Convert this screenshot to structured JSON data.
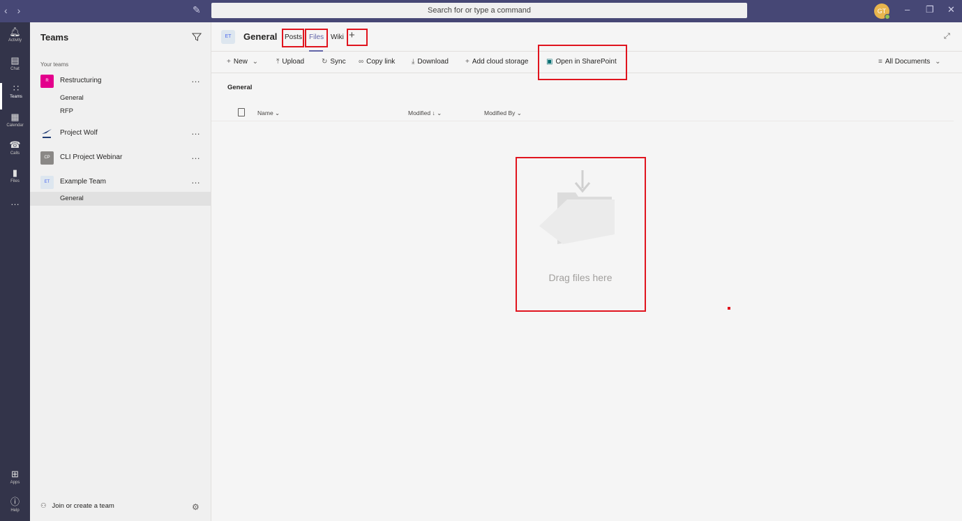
{
  "titlebar": {
    "search_placeholder": "Search for or type a command",
    "user_initials": "GT",
    "back_icon": "chevron-left-icon",
    "forward_icon": "chevron-right-icon"
  },
  "rail": {
    "activity": "Activity",
    "chat": "Chat",
    "teams": "Teams",
    "calendar": "Calendar",
    "calls": "Calls",
    "files": "Files",
    "apps": "Apps",
    "help": "Help"
  },
  "sidebar": {
    "title": "Teams",
    "your_teams_label": "Your teams",
    "teams": [
      {
        "initials": "R",
        "name": "Restructuring",
        "channels": [
          "General",
          "RFP"
        ]
      },
      {
        "initials": "",
        "name": "Project Wolf"
      },
      {
        "initials": "CP",
        "name": "CLI Project Webinar"
      },
      {
        "initials": "ET",
        "name": "Example Team",
        "channels": [
          "General"
        ]
      }
    ],
    "join_label": "Join or create a team"
  },
  "channel": {
    "initials": "ET",
    "title": "General",
    "tabs": [
      "Posts",
      "Files",
      "Wiki"
    ],
    "active_tab": "Files"
  },
  "toolbar": {
    "new": "New",
    "upload": "Upload",
    "sync": "Sync",
    "copy_link": "Copy link",
    "download": "Download",
    "add_cloud": "Add cloud storage",
    "open_sharepoint": "Open in SharePoint",
    "view": "All Documents"
  },
  "files": {
    "breadcrumb": "General",
    "col_name": "Name",
    "col_modified": "Modified",
    "col_modified_by": "Modified By",
    "empty_text": "Drag files here"
  },
  "colors": {
    "titlebar": "#464775",
    "rail": "#33344a",
    "accent": "#6264a7",
    "highlight": "#e0141e"
  }
}
